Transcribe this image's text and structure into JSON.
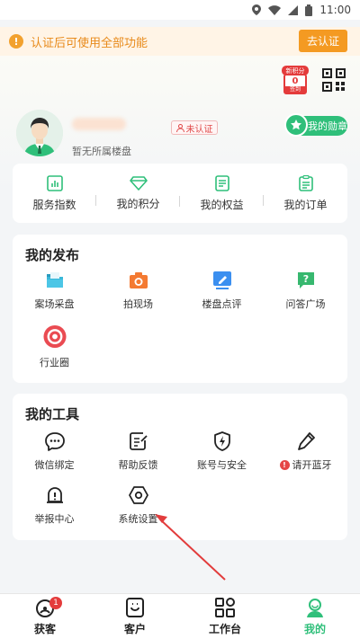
{
  "status_bar": {
    "time": "11:00"
  },
  "notice": {
    "icon": "!",
    "text": "认证后可使用全部功能",
    "button": "去认证"
  },
  "header": {
    "checkin": {
      "badge": "新积分",
      "count": "0",
      "label": "签到"
    },
    "qr_icon": "qr-code-icon"
  },
  "profile": {
    "estate_text": "暂无所属楼盘",
    "verify_status": "未认证",
    "medal_label": "我的勋章"
  },
  "stats": [
    {
      "label": "服务指数",
      "icon": "chart-icon"
    },
    {
      "label": "我的积分",
      "icon": "diamond-icon"
    },
    {
      "label": "我的权益",
      "icon": "document-icon"
    },
    {
      "label": "我的订单",
      "icon": "clipboard-icon"
    }
  ],
  "publish": {
    "title": "我的发布",
    "items": [
      {
        "label": "案场采盘",
        "icon": "folder-icon"
      },
      {
        "label": "拍现场",
        "icon": "camera-icon"
      },
      {
        "label": "楼盘点评",
        "icon": "edit-icon"
      },
      {
        "label": "问答广场",
        "icon": "question-icon"
      },
      {
        "label": "行业圈",
        "icon": "circle-icon"
      }
    ]
  },
  "tools": {
    "title": "我的工具",
    "items": [
      {
        "label": "微信绑定",
        "icon": "chat-bubble-icon"
      },
      {
        "label": "帮助反馈",
        "icon": "feedback-icon"
      },
      {
        "label": "账号与安全",
        "icon": "shield-icon"
      },
      {
        "label": "请开蓝牙",
        "icon": "pen-icon",
        "warning": "!"
      },
      {
        "label": "举报中心",
        "icon": "report-icon"
      },
      {
        "label": "系统设置",
        "icon": "settings-icon"
      }
    ]
  },
  "tabbar": {
    "items": [
      {
        "label": "获客",
        "badge": "1"
      },
      {
        "label": "客户"
      },
      {
        "label": "工作台"
      },
      {
        "label": "我的"
      }
    ]
  },
  "colors": {
    "accent": "#2fbf7a",
    "warning": "#f49a22",
    "danger": "#e43b3b"
  }
}
